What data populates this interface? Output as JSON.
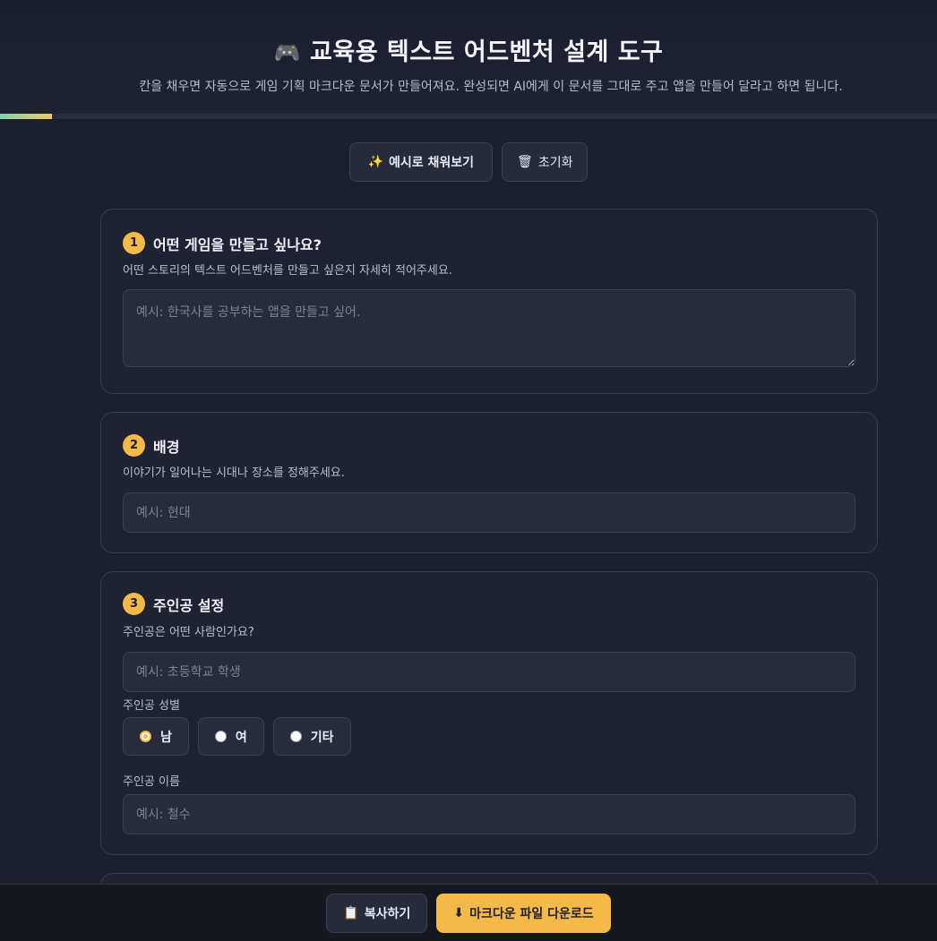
{
  "header": {
    "emoji": "🎮",
    "title": "교육용 텍스트 어드벤처 설계 도구",
    "subtitle": "칸을 채우면 자동으로 게임 기획 마크다운 문서가 만들어져요. 완성되면 AI에게 이 문서를 그대로 주고 앱을 만들어 달라고 하면 됩니다.",
    "progress_percent": 5.5
  },
  "actions": {
    "example_icon": "✨",
    "example_label": "예시로 채워보기",
    "reset_icon": "🗑",
    "reset_label": "초기화"
  },
  "sections": [
    {
      "number": "1",
      "title": "어떤 게임을 만들고 싶나요?",
      "description": "어떤 스토리의 텍스트 어드벤처를 만들고 싶은지 자세히 적어주세요.",
      "placeholder": "예시: 한국사를 공부하는 앱을 만들고 싶어.",
      "value": ""
    },
    {
      "number": "2",
      "title": "배경",
      "description": "이야기가 일어나는 시대나 장소를 정해주세요.",
      "placeholder": "예시: 현대",
      "value": ""
    },
    {
      "number": "3",
      "title": "주인공 설정",
      "description": "주인공은 어떤 사람인가요?",
      "placeholder": "예시: 초등학교 학생",
      "value": "",
      "gender_label": "주인공 성별",
      "gender_options": [
        "남",
        "여",
        "기타"
      ],
      "gender_selected": "남",
      "name_label": "주인공 이름",
      "name_placeholder": "예시: 철수",
      "name_value": ""
    }
  ],
  "footer": {
    "copy_icon": "📋",
    "copy_label": "복사하기",
    "download_icon": "⬇",
    "download_label": "마크다운 파일 다운로드"
  },
  "colors": {
    "background": "#1b1f2e",
    "accent": "#f5b94a",
    "card": "#1e2232"
  }
}
